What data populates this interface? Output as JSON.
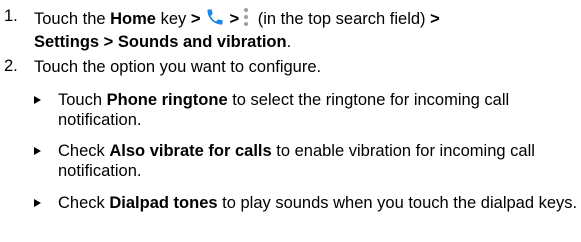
{
  "step1": {
    "number": "1.",
    "text_a": "Touch the ",
    "home": "Home",
    "text_b": " key ",
    "gt1": ">",
    "gt2": ">",
    "text_c": " (in the top search field) ",
    "gt3": ">",
    "settings_path": "Settings > Sounds and vibration",
    "period": ".",
    "phone_icon": "phone-icon",
    "phone_icon_color": "#1e88e5",
    "more_icon": "more-vertical-icon",
    "more_icon_color": "#9e9e9e"
  },
  "step2": {
    "number": "2.",
    "text": "Touch the option you want to configure."
  },
  "bullets": [
    {
      "pre": "Touch ",
      "bold": "Phone ringtone",
      "post": " to select the ringtone for incoming call notification."
    },
    {
      "pre": "Check ",
      "bold": "Also vibrate for calls",
      "post": " to enable vibration for incoming call notification."
    },
    {
      "pre": "Check ",
      "bold": "Dialpad tones",
      "post": " to play sounds when you touch the dialpad keys."
    }
  ]
}
